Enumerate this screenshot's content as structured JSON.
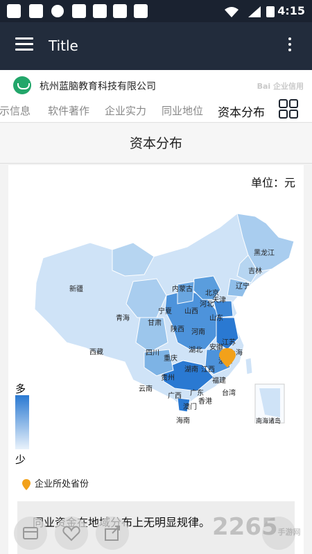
{
  "status": {
    "time": "4:15"
  },
  "app_bar": {
    "title": "Title"
  },
  "company": {
    "name": "杭州蓝脑教育科技有限公司",
    "watermark": "Bai 企业信用"
  },
  "tabs": [
    {
      "label": "示信息"
    },
    {
      "label": "软件著作"
    },
    {
      "label": "企业实力"
    },
    {
      "label": "同业地位"
    },
    {
      "label": "资本分布",
      "active": true
    }
  ],
  "section": {
    "title": "资本分布"
  },
  "map": {
    "unit": "单位：元",
    "legend_high": "多",
    "legend_low": "少",
    "pin_label": "企业所处省份",
    "colors": {
      "light": "#cfe3f7",
      "mid": "#9cc6ec",
      "dark": "#4d93db",
      "darkest": "#2a79d2",
      "pin": "#f2a11a"
    },
    "provinces": [
      "新疆",
      "西藏",
      "青海",
      "甘肃",
      "内蒙古",
      "宁夏",
      "陕西",
      "四川",
      "云南",
      "贵州",
      "重庆",
      "湖北",
      "湖南",
      "广西",
      "广东",
      "海南",
      "澳门",
      "香港",
      "台湾",
      "福建",
      "江西",
      "浙江",
      "安徽",
      "上海",
      "江苏",
      "山东",
      "河南",
      "山西",
      "河北",
      "北京",
      "天津",
      "辽宁",
      "吉林",
      "黑龙江",
      "南海诸岛"
    ]
  },
  "summary": {
    "text": "同业资金在地域分布上无明显规律。"
  },
  "watermark": {
    "brand": "2265",
    "sub": "手游网"
  }
}
